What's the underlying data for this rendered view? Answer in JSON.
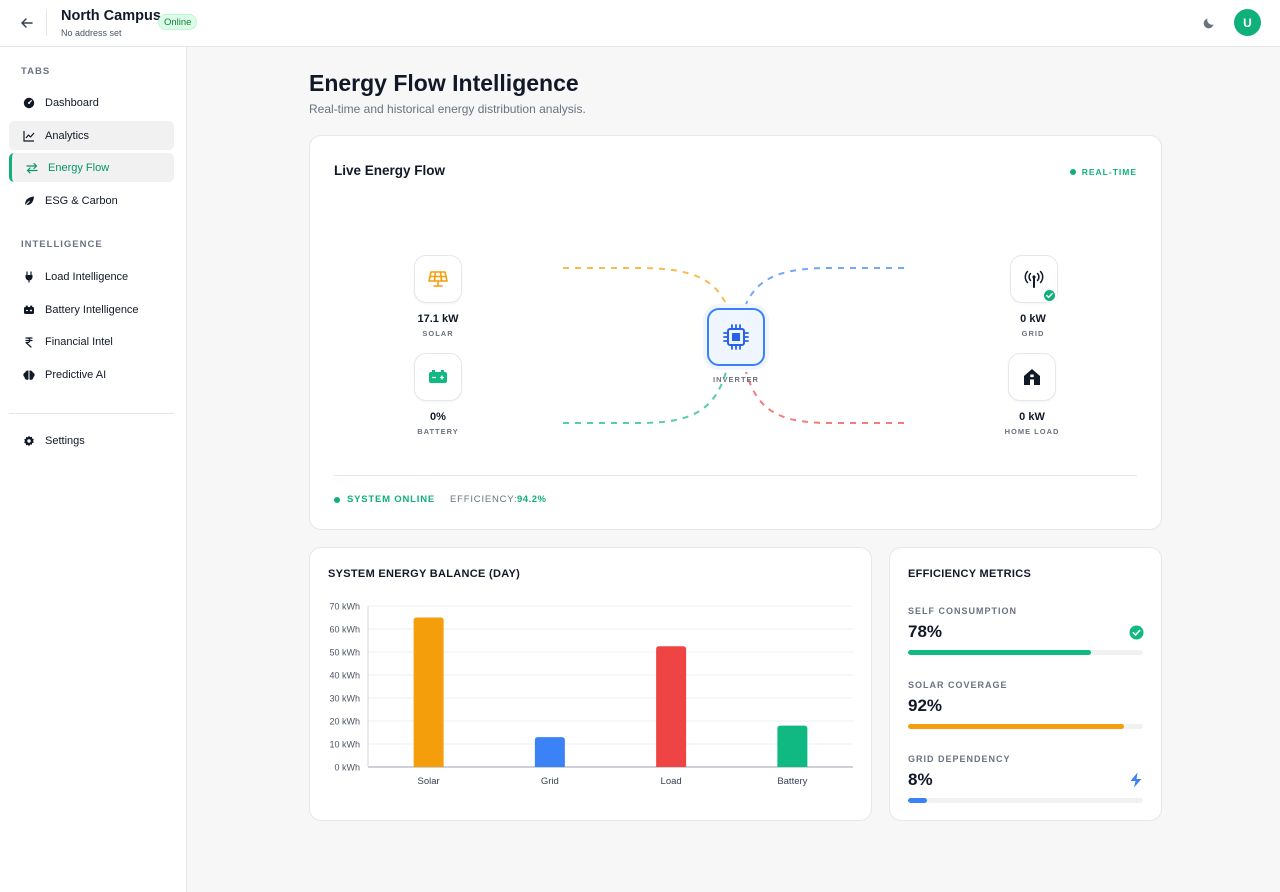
{
  "header": {
    "title": "North Campus",
    "status": "Online",
    "subtitle": "No address set",
    "avatar_letter": "U"
  },
  "sidebar": {
    "sections": [
      {
        "label": "TABS"
      },
      {
        "label": "INTELLIGENCE"
      }
    ],
    "items": [
      {
        "label": "Dashboard",
        "icon": "gauge-icon"
      },
      {
        "label": "Analytics",
        "icon": "line-chart-icon"
      },
      {
        "label": "Energy Flow",
        "icon": "arrows-swap-icon"
      },
      {
        "label": "ESG & Carbon",
        "icon": "leaf-icon"
      },
      {
        "label": "Load Intelligence",
        "icon": "plug-icon"
      },
      {
        "label": "Battery Intelligence",
        "icon": "battery-icon"
      },
      {
        "label": "Financial Intel",
        "icon": "rupee-icon"
      },
      {
        "label": "Predictive AI",
        "icon": "brain-icon"
      },
      {
        "label": "Settings",
        "icon": "gear-icon"
      }
    ],
    "active_item": "Energy Flow"
  },
  "page": {
    "title": "Energy Flow Intelligence",
    "subtitle": "Real-time and historical energy distribution analysis."
  },
  "flow": {
    "title": "Live Energy Flow",
    "badge": "REAL-TIME",
    "nodes": {
      "solar": {
        "value": "17.1 kW",
        "label": "SOLAR"
      },
      "battery": {
        "value": "0%",
        "label": "BATTERY"
      },
      "grid": {
        "value": "0 kW",
        "label": "GRID"
      },
      "home": {
        "value": "0 kW",
        "label": "HOME LOAD"
      },
      "inverter": {
        "label": "INVERTER"
      }
    },
    "system_status": "SYSTEM ONLINE",
    "efficiency_label": "EFFICIENCY:",
    "efficiency_value": "94.2%"
  },
  "balance": {
    "title": "SYSTEM ENERGY BALANCE (DAY)"
  },
  "chart_data": {
    "type": "bar",
    "categories": [
      "Solar",
      "Grid",
      "Load",
      "Battery"
    ],
    "values": [
      65,
      13,
      52.5,
      18
    ],
    "colors": [
      "#f59e0b",
      "#3b82f6",
      "#ef4444",
      "#10b981"
    ],
    "ylim": [
      0,
      70
    ],
    "yticks": [
      "0 kWh",
      "10 kWh",
      "20 kWh",
      "30 kWh",
      "40 kWh",
      "50 kWh",
      "60 kWh",
      "70 kWh"
    ],
    "grid": true,
    "title": "",
    "xlabel": "",
    "ylabel": ""
  },
  "efficiency": {
    "title": "EFFICIENCY METRICS",
    "metrics": [
      {
        "label": "SELF CONSUMPTION",
        "value": "78%",
        "fraction": 0.78,
        "color": "#10b981",
        "icon": "check-circle-icon"
      },
      {
        "label": "SOLAR COVERAGE",
        "value": "92%",
        "fraction": 0.92,
        "color": "#f59e0b",
        "icon": ""
      },
      {
        "label": "GRID DEPENDENCY",
        "value": "8%",
        "fraction": 0.08,
        "color": "#3b82f6",
        "icon": "lightning-icon"
      }
    ]
  }
}
